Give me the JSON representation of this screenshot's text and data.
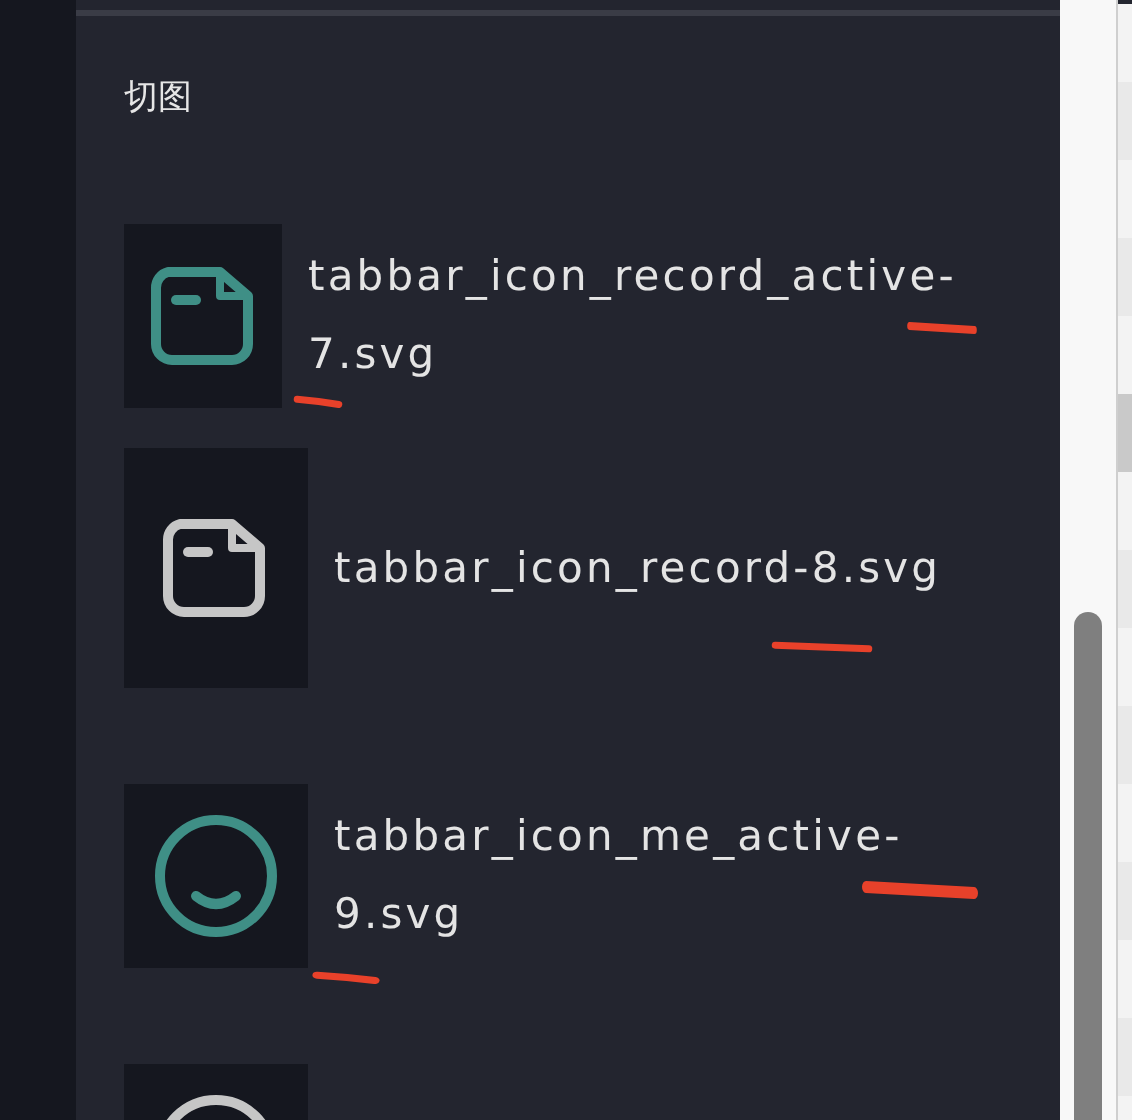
{
  "section_title": "切图",
  "assets": [
    {
      "kind": "folder",
      "active": true,
      "name": "tabbar_icon_record_active-7.svg",
      "marked": true
    },
    {
      "kind": "folder",
      "active": false,
      "name": "tabbar_icon_record-8.svg",
      "marked": true
    },
    {
      "kind": "face",
      "active": true,
      "name": "tabbar_icon_me_active-9.svg",
      "marked": true
    },
    {
      "kind": "face",
      "active": false,
      "marked": false
    }
  ],
  "side_list": [
    {
      "selected": false
    },
    {
      "selected": false
    },
    {
      "selected": false
    },
    {
      "selected": false
    },
    {
      "selected": false
    },
    {
      "selected": true
    },
    {
      "selected": false
    },
    {
      "selected": false
    },
    {
      "selected": false
    },
    {
      "selected": false
    },
    {
      "selected": false
    },
    {
      "selected": false
    },
    {
      "selected": false
    },
    {
      "selected": false
    },
    {
      "selected": false
    }
  ]
}
